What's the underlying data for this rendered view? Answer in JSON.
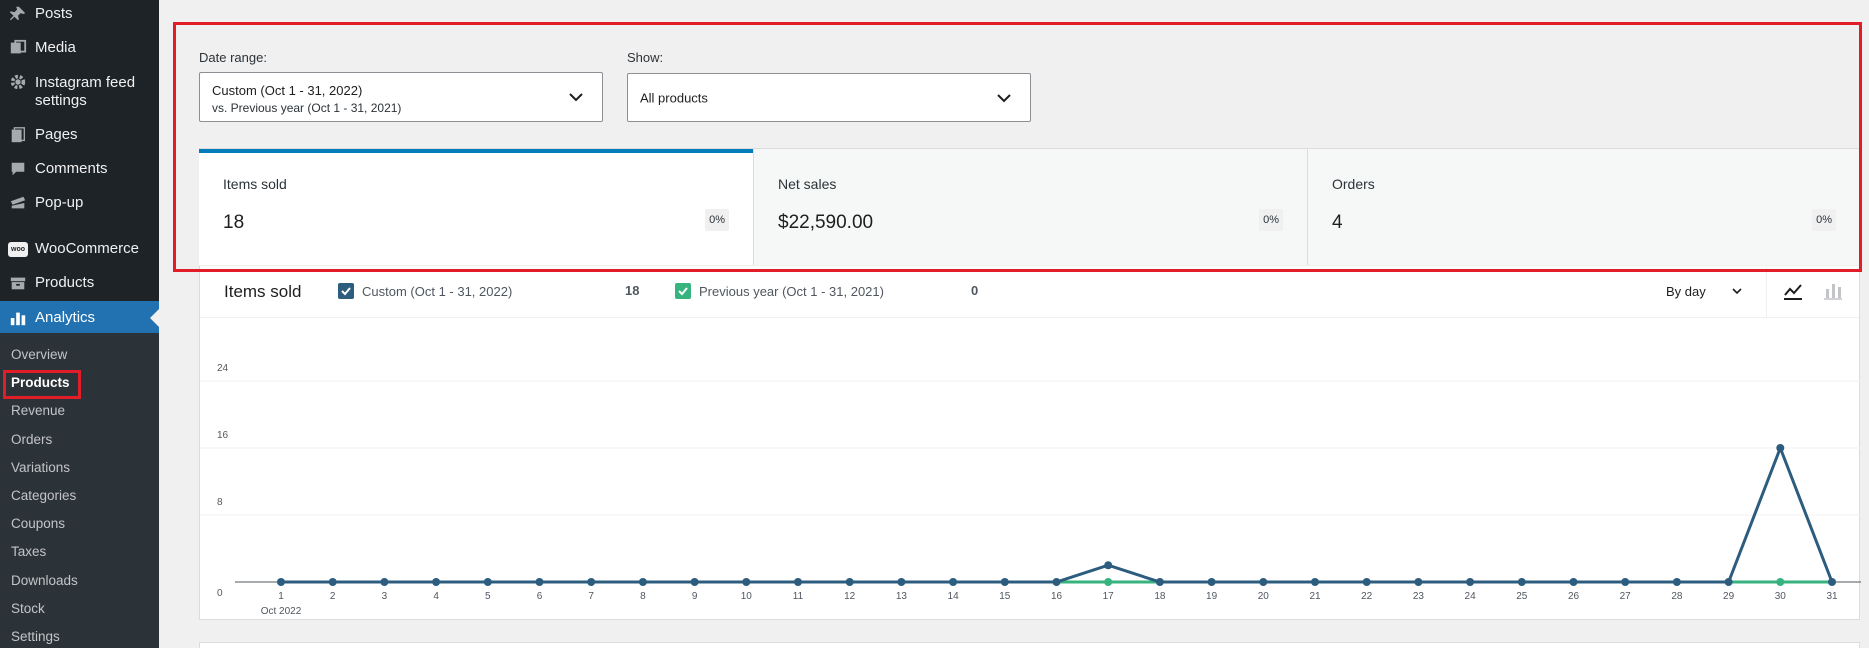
{
  "sidebar": {
    "items": [
      {
        "label": "Posts",
        "icon": "pin-icon"
      },
      {
        "label": "Media",
        "icon": "media-icon"
      },
      {
        "label": "Instagram feed settings",
        "label_line1": "Instagram feed",
        "label_line2": "settings",
        "icon": "gear-icon"
      },
      {
        "label": "Pages",
        "icon": "pages-icon"
      },
      {
        "label": "Comments",
        "icon": "comments-icon"
      },
      {
        "label": "Pop-up",
        "icon": "popup-icon"
      },
      {
        "label": "WooCommerce",
        "icon": "woo-icon",
        "icon_text": "woo"
      },
      {
        "label": "Products",
        "icon": "products-icon"
      },
      {
        "label": "Analytics",
        "icon": "analytics-icon",
        "active": true
      }
    ],
    "submenu": [
      "Overview",
      "Products",
      "Revenue",
      "Orders",
      "Variations",
      "Categories",
      "Coupons",
      "Taxes",
      "Downloads",
      "Stock",
      "Settings"
    ],
    "current_submenu": "Products"
  },
  "filters": {
    "date_range_label": "Date range:",
    "date_range_main": "Custom (Oct 1 - 31, 2022)",
    "date_range_compare": "vs. Previous year (Oct 1 - 31, 2021)",
    "show_label": "Show:",
    "show_value": "All products"
  },
  "summary": [
    {
      "label": "Items sold",
      "value": "18",
      "delta": "0%",
      "selected": true
    },
    {
      "label": "Net sales",
      "value": "$22,590.00",
      "delta": "0%",
      "selected": false
    },
    {
      "label": "Orders",
      "value": "4",
      "delta": "0%",
      "selected": false
    }
  ],
  "chart_header": {
    "title": "Items sold",
    "legend_primary": "Custom (Oct 1 - 31, 2022)",
    "legend_primary_total": "18",
    "legend_secondary": "Previous year (Oct 1 - 31, 2021)",
    "legend_secondary_total": "0",
    "interval": "By day"
  },
  "colors": {
    "primary_series": "#2c5c7e",
    "secondary_series": "#36b37e",
    "accent": "#2271b1",
    "highlight": "#e11d2a"
  },
  "chart_data": {
    "type": "line",
    "x": [
      1,
      2,
      3,
      4,
      5,
      6,
      7,
      8,
      9,
      10,
      11,
      12,
      13,
      14,
      15,
      16,
      17,
      18,
      19,
      20,
      21,
      22,
      23,
      24,
      25,
      26,
      27,
      28,
      29,
      30,
      31
    ],
    "x_tick_labels": [
      "1",
      "2",
      "3",
      "4",
      "5",
      "6",
      "7",
      "8",
      "9",
      "10",
      "11",
      "12",
      "13",
      "14",
      "15",
      "16",
      "17",
      "18",
      "19",
      "20",
      "21",
      "22",
      "23",
      "24",
      "25",
      "26",
      "27",
      "28",
      "29",
      "30",
      "31"
    ],
    "x_sublabel": "Oct 2022",
    "y_ticks": [
      0,
      8,
      16,
      24
    ],
    "ylim": [
      0,
      24
    ],
    "series": [
      {
        "name": "Custom (Oct 1 - 31, 2022)",
        "values": [
          0,
          0,
          0,
          0,
          0,
          0,
          0,
          0,
          0,
          0,
          0,
          0,
          0,
          0,
          0,
          0,
          2,
          0,
          0,
          0,
          0,
          0,
          0,
          0,
          0,
          0,
          0,
          0,
          0,
          16,
          0
        ]
      },
      {
        "name": "Previous year (Oct 1 - 31, 2021)",
        "values": [
          0,
          0,
          0,
          0,
          0,
          0,
          0,
          0,
          0,
          0,
          0,
          0,
          0,
          0,
          0,
          0,
          0,
          0,
          0,
          0,
          0,
          0,
          0,
          0,
          0,
          0,
          0,
          0,
          0,
          0,
          0
        ]
      }
    ]
  }
}
